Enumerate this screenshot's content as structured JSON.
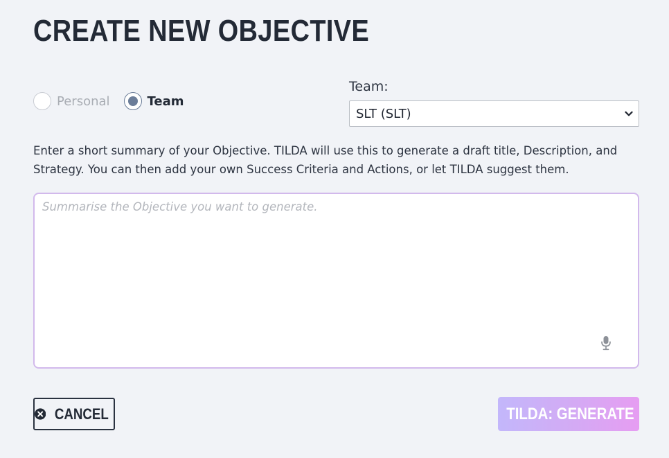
{
  "page": {
    "title": "CREATE NEW OBJECTIVE"
  },
  "type_selector": {
    "options": [
      {
        "label": "Personal",
        "checked": false,
        "disabled": true
      },
      {
        "label": "Team",
        "checked": true,
        "disabled": false
      }
    ]
  },
  "team": {
    "label": "Team:",
    "selected": "SLT (SLT)"
  },
  "instructions": "Enter a short summary of your Objective. TILDA will use this to generate a draft title, Description, and Strategy. You can then add your own Success Criteria and Actions, or let TILDA suggest them.",
  "summary": {
    "value": "",
    "placeholder": "Summarise the Objective you want to generate."
  },
  "buttons": {
    "cancel_label": "CANCEL",
    "generate_label": "TILDA: GENERATE"
  },
  "colors": {
    "background": "#f1f3f7",
    "text": "#2d3441",
    "radio_accent": "#6b7d99",
    "textarea_border": "#d2b9ec",
    "generate_gradient_start": "#c3b7fb",
    "generate_gradient_end": "#e69df2"
  },
  "icons": {
    "select_arrow": "chevron-down-icon",
    "microphone": "microphone-icon",
    "cancel": "close-circle-icon",
    "generate": "sparkle-icon"
  }
}
